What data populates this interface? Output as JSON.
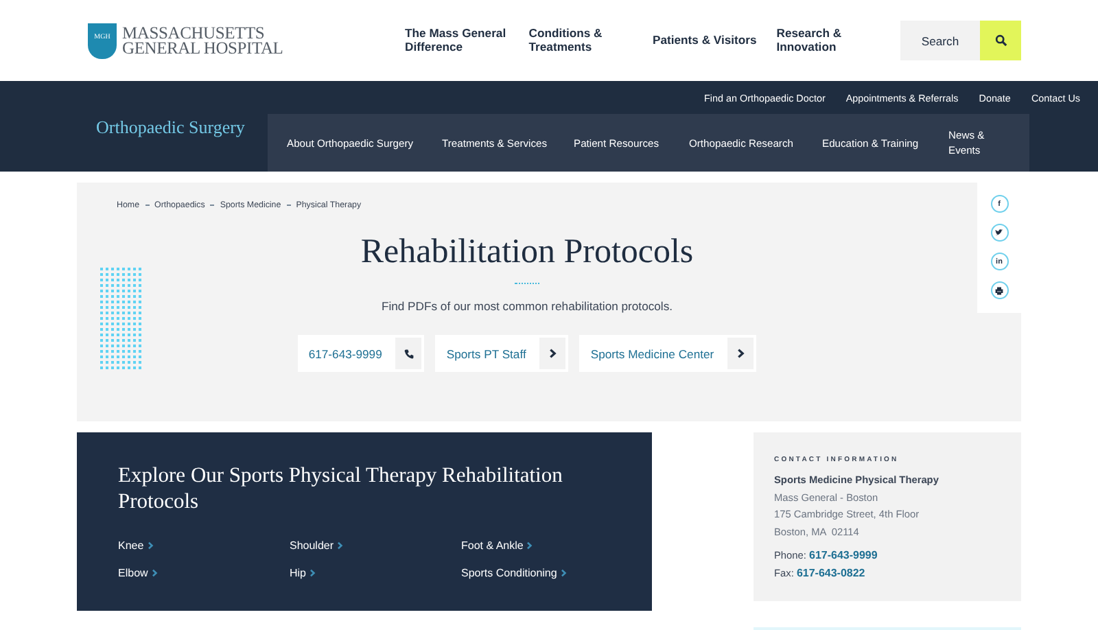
{
  "header": {
    "logo_mark": "MGH",
    "logo_text": [
      "MASSACHUSETTS",
      "GENERAL HOSPITAL"
    ],
    "nav": [
      "The Mass General Difference",
      "Conditions & Treatments",
      "Patients & Visitors",
      "Research & Innovation"
    ],
    "search": {
      "label": "Search"
    }
  },
  "department": {
    "title": "Orthopaedic Surgery",
    "utility_links": [
      "Find an Orthopaedic Doctor",
      "Appointments & Referrals",
      "Donate",
      "Contact Us"
    ],
    "subnav": [
      "About Orthopaedic Surgery",
      "Treatments & Services",
      "Patient Resources",
      "Orthopaedic Research",
      "Education & Training",
      "News & Events"
    ]
  },
  "hero": {
    "breadcrumbs": [
      "Home",
      "Orthopaedics",
      "Sports Medicine",
      "Physical Therapy"
    ],
    "title": "Rehabilitation Protocols",
    "subtitle": "Find PDFs of our most common rehabilitation protocols.",
    "actions": [
      {
        "label": "617-643-9999",
        "kind": "phone"
      },
      {
        "label": "Sports PT Staff",
        "kind": "link"
      },
      {
        "label": "Sports Medicine Center",
        "kind": "link"
      }
    ]
  },
  "share": [
    {
      "kind": "facebook",
      "glyph": "f"
    },
    {
      "kind": "twitter"
    },
    {
      "kind": "linkedin",
      "glyph": "in"
    },
    {
      "kind": "print"
    }
  ],
  "protocols": {
    "title": "Explore Our Sports Physical Therapy Rehabilitation Protocols",
    "links": [
      "Knee",
      "Shoulder",
      "Foot & Ankle",
      "Elbow",
      "Hip",
      "Sports Conditioning"
    ]
  },
  "contact": {
    "heading": "CONTACT INFORMATION",
    "name": "Sports Medicine Physical Therapy",
    "address": [
      "Mass General - Boston",
      "175 Cambridge Street, 4th Floor",
      "Boston, MA  02114"
    ],
    "phone": {
      "label": "Phone:",
      "value": "617-643-9999"
    },
    "fax": {
      "label": "Fax:",
      "value": "617-643-0822"
    }
  }
}
